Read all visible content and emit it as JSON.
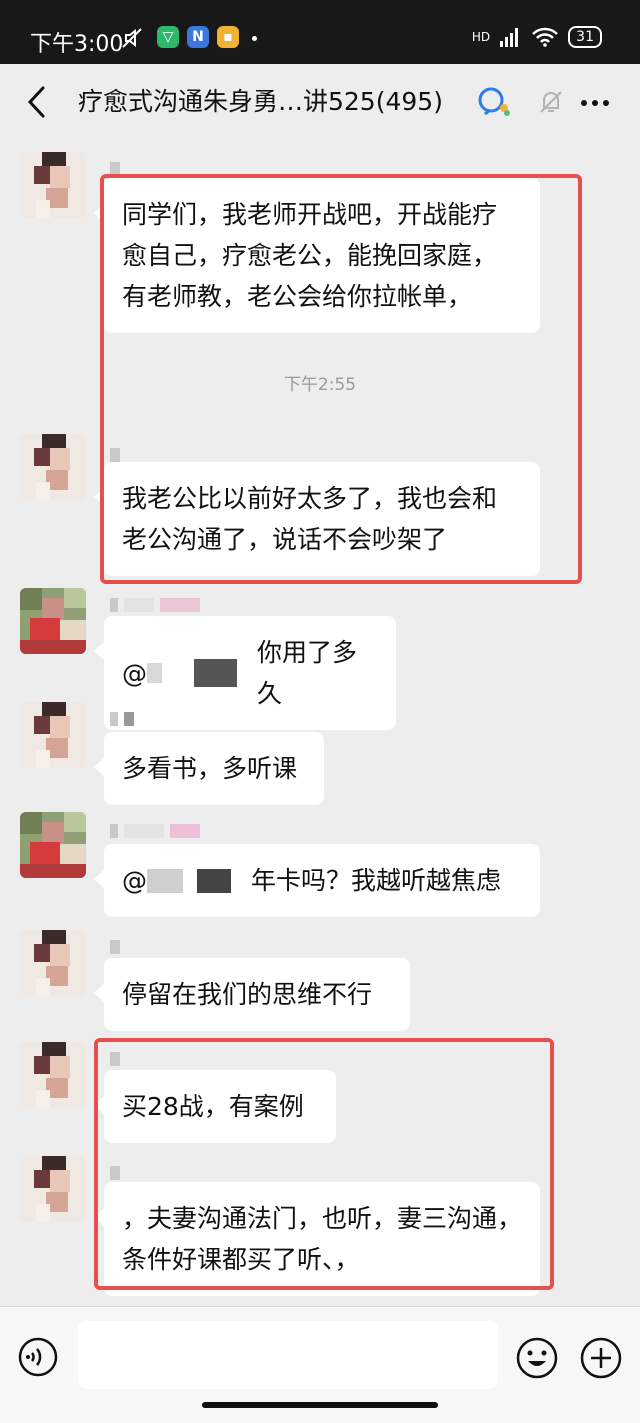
{
  "status_bar": {
    "time": "下午3:00",
    "network": "HD",
    "battery": "31",
    "icons": [
      "mute-icon",
      "shield-app-icon",
      "n-app-icon",
      "note-app-icon",
      "dot-icon",
      "signal-icon",
      "wifi-icon",
      "battery-icon"
    ]
  },
  "header": {
    "title": "疗愈式沟通朱身勇…讲525(495)",
    "icons": [
      "back-icon",
      "group-bot-icon",
      "mute-bell-icon",
      "more-icon"
    ]
  },
  "messages": [
    {
      "text": "同学们，我老师开战吧，开战能疗愈自己，疗愈老公，能挽回家庭，有老师教，老公会给你拉帐单，",
      "lines": [
        "同学们，我老师开战吧，开战能疗",
        "愈自己，疗愈老公，能挽回家庭，",
        "有老师教，老公会给你拉帐单，"
      ]
    },
    {
      "timestamp": "下午2:55"
    },
    {
      "lines": [
        "我老公比以前好太多了，我也会和",
        "老公沟通了，说话不会吵架了"
      ]
    },
    {
      "prefix": "@",
      "text": "你用了多久"
    },
    {
      "text": "多看书，多听课"
    },
    {
      "prefix": "@",
      "text": "年卡吗？我越听越焦虑"
    },
    {
      "text": "停留在我们的思维不行"
    },
    {
      "text": "买28战，有案例"
    },
    {
      "lines": [
        "，夫妻沟通法门，也听，妻三沟通，",
        "条件好课都买了听、，"
      ]
    }
  ],
  "colors": {
    "highlight_box": "#e45050",
    "bubble": "#ffffff",
    "background": "#ededed"
  }
}
